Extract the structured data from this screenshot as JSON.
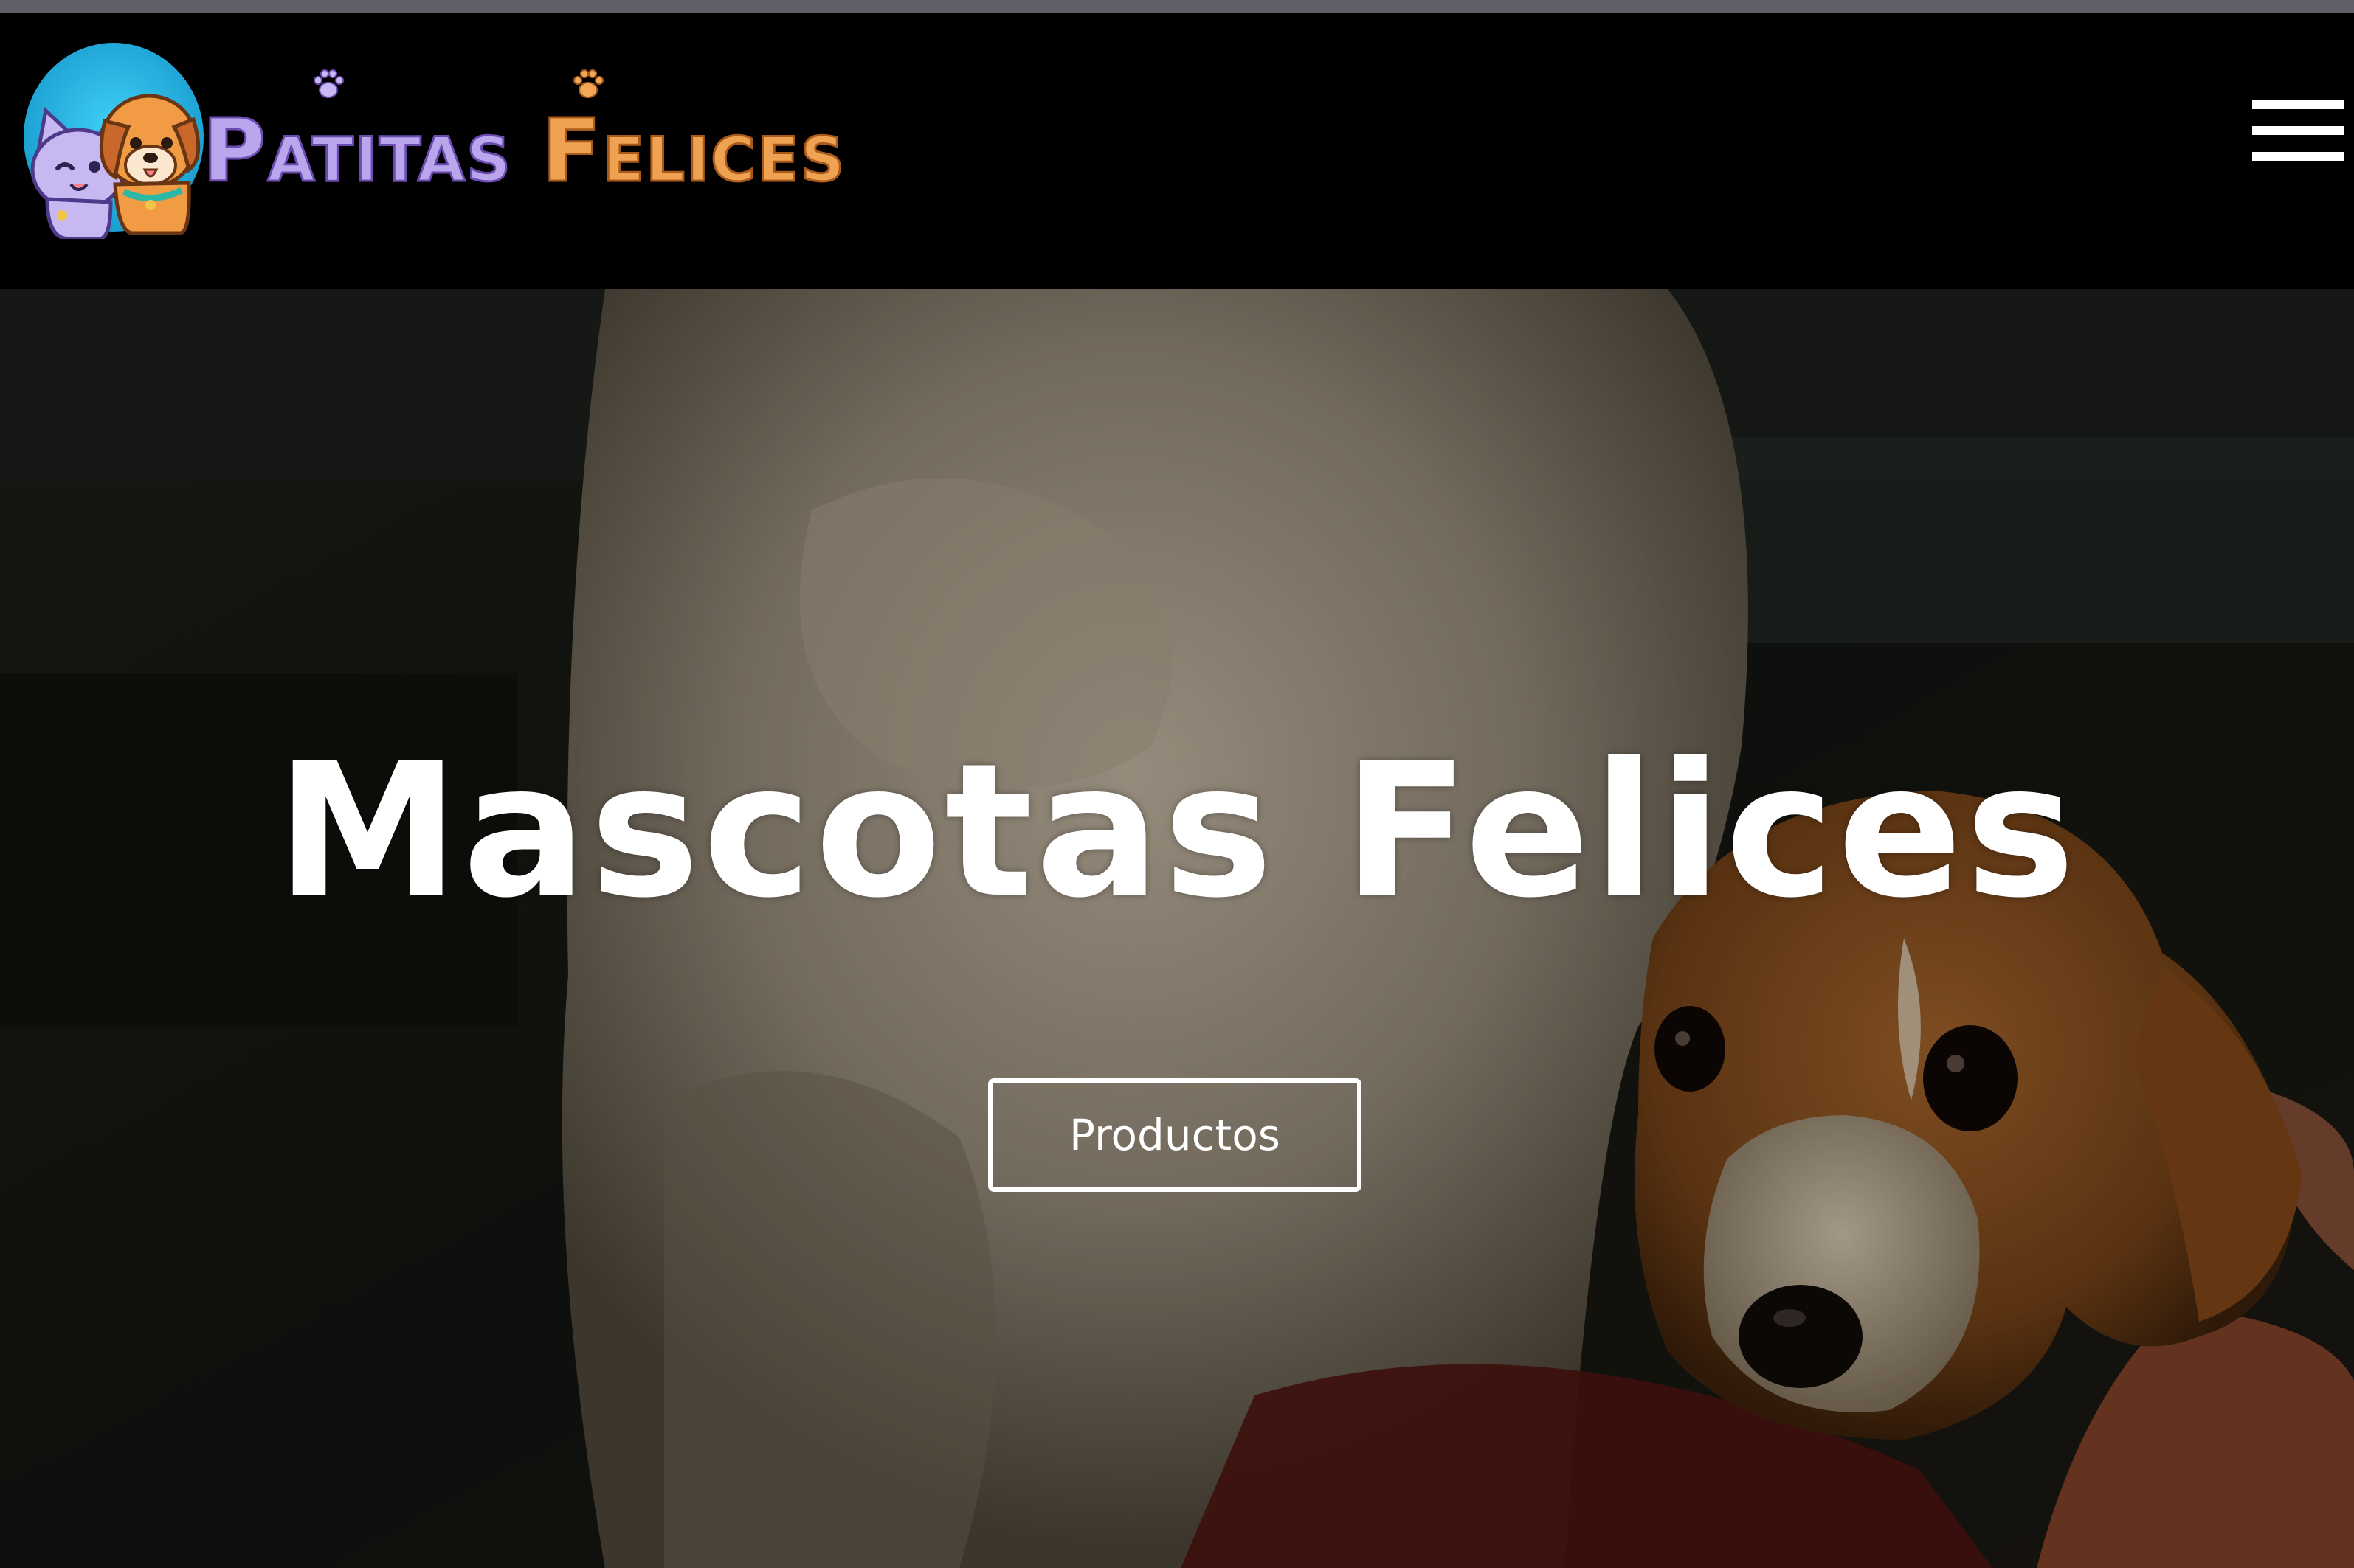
{
  "header": {
    "logo": {
      "word_1": "Patitas",
      "word_2": "Felices",
      "emblem_icon": "cat-and-dog-icon",
      "paw_icon": "paw-icon"
    },
    "menu_icon": "hamburger-menu-icon"
  },
  "hero": {
    "title": "Mascotas Felices",
    "cta_label": "Productos",
    "background": "photo of a white long-haired dog and a small brown-and-white dog"
  },
  "colors": {
    "header_bg": "#000000",
    "logo_purple": "#b9a6ec",
    "logo_orange": "#f0a253",
    "hero_text": "#ffffff",
    "emblem_blue": "#2bb8e6"
  }
}
